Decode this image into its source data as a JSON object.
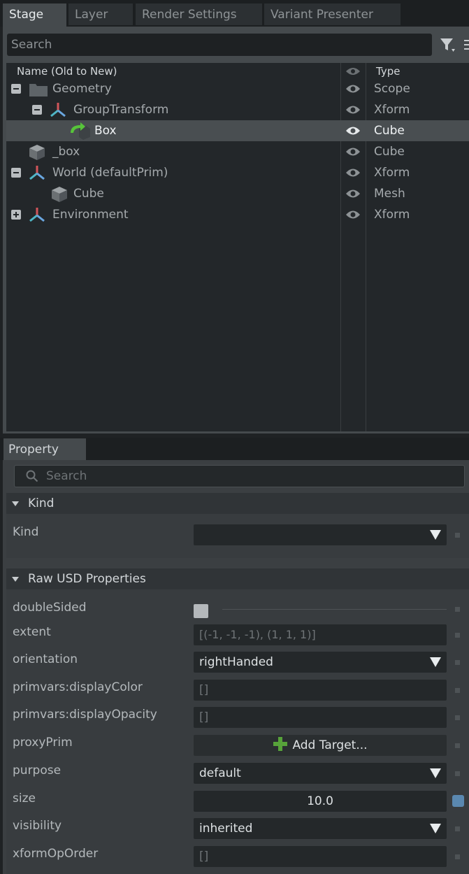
{
  "tabs": [
    "Stage",
    "Layer",
    "Render Settings",
    "Variant Presenter"
  ],
  "stage": {
    "search_placeholder": "Search",
    "columns": {
      "name": "Name (Old to New)",
      "type": "Type"
    },
    "rows": [
      {
        "name": "Geometry",
        "type": "Scope",
        "icon": "folder-icon",
        "expander": "collapse"
      },
      {
        "name": "GroupTransform",
        "type": "Xform",
        "icon": "xform-icon",
        "expander": "collapse"
      },
      {
        "name": "Box",
        "type": "Cube",
        "icon": "cube-reference-icon",
        "expander": "none",
        "selected": true
      },
      {
        "name": "_box",
        "type": "Cube",
        "icon": "cube-icon",
        "expander": "none"
      },
      {
        "name": "World (defaultPrim)",
        "type": "Xform",
        "icon": "xform-icon",
        "expander": "collapse"
      },
      {
        "name": "Cube",
        "type": "Mesh",
        "icon": "cube-icon",
        "expander": "none"
      },
      {
        "name": "Environment",
        "type": "Xform",
        "icon": "xform-icon",
        "expander": "expand"
      }
    ]
  },
  "property": {
    "tab": "Property",
    "search_placeholder": "Search",
    "kind_section": {
      "title": "Kind",
      "label": "Kind",
      "value": ""
    },
    "raw_section": {
      "title": "Raw USD Properties",
      "props": {
        "doubleSided": {
          "label": "doubleSided"
        },
        "extent": {
          "label": "extent",
          "value": "[(-1, -1, -1), (1, 1, 1)]"
        },
        "orientation": {
          "label": "orientation",
          "value": "rightHanded"
        },
        "displayColor": {
          "label": "primvars:displayColor",
          "value": "[]"
        },
        "displayOpacity": {
          "label": "primvars:displayOpacity",
          "value": "[]"
        },
        "proxyPrim": {
          "label": "proxyPrim",
          "value": "Add Target..."
        },
        "purpose": {
          "label": "purpose",
          "value": "default"
        },
        "size": {
          "label": "size",
          "value": "10.0"
        },
        "visibility": {
          "label": "visibility",
          "value": "inherited"
        },
        "xformOpOrder": {
          "label": "xformOpOrder",
          "value": "[]"
        }
      }
    }
  },
  "colors": {
    "selected_row": "#494e51",
    "accent_green": "#57c43a",
    "size_marker": "#5a88b0"
  }
}
